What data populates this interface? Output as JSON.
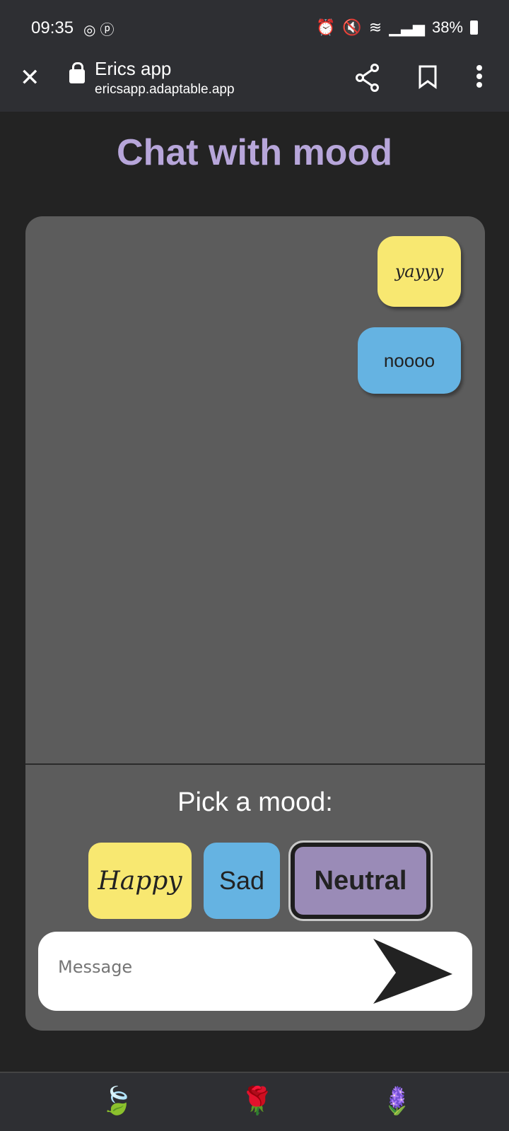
{
  "status_bar": {
    "time": "09:35",
    "battery": "38%",
    "left_icons": [
      "instagram-icon",
      "pinterest-icon"
    ],
    "right_icons": [
      "battery-saver-icon",
      "alarm-icon",
      "mute-icon",
      "wifi-icon",
      "signal-icon"
    ]
  },
  "browser": {
    "title": "Erics app",
    "url": "ericsapp.adaptable.app"
  },
  "page": {
    "title": "Chat with mood"
  },
  "messages": [
    {
      "text": "yayyy",
      "mood": "Happy"
    },
    {
      "text": "noooo",
      "mood": "Sad"
    }
  ],
  "mood_picker": {
    "label": "Pick a mood:",
    "options": [
      "Happy",
      "Sad",
      "Neutral"
    ],
    "selected": "Neutral"
  },
  "composer": {
    "placeholder": "Message",
    "value": ""
  },
  "colors": {
    "happy": "#f8e871",
    "sad": "#65b3e2",
    "neutral": "#9a8bb7",
    "title": "#b7a6da"
  }
}
